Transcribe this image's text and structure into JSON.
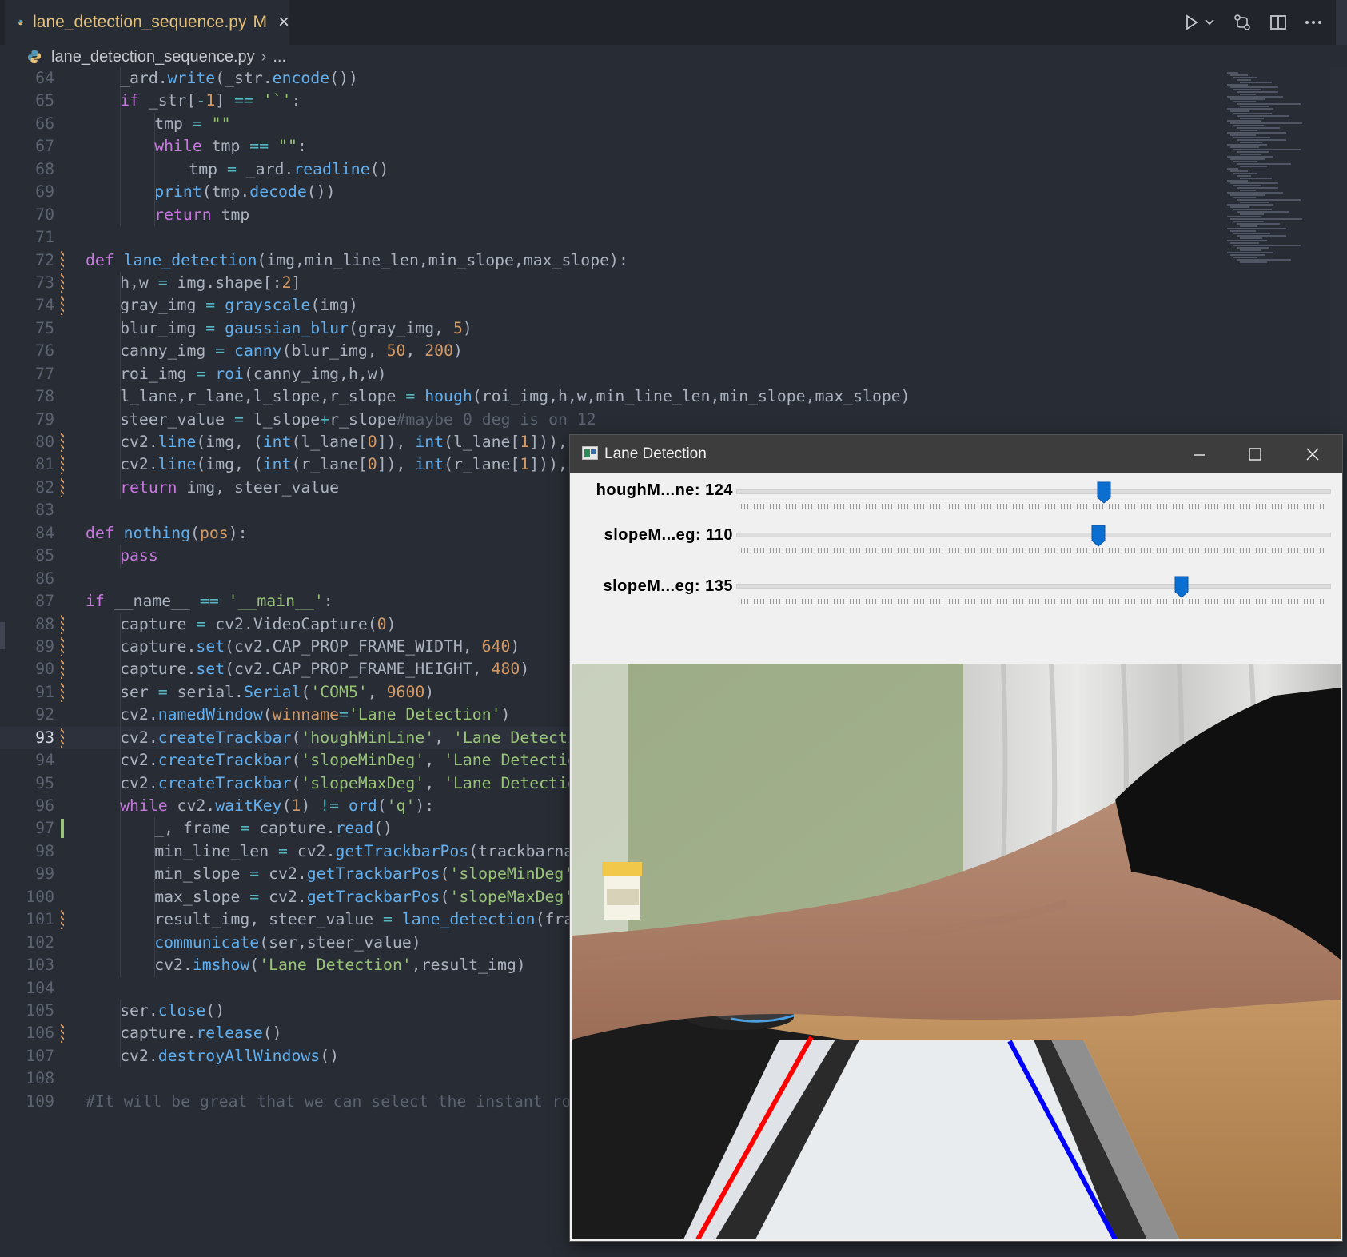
{
  "tab": {
    "filename": "lane_detection_sequence.py",
    "modified_badge": "M",
    "close_glyph": "×"
  },
  "breadcrumb": {
    "file": "lane_detection_sequence.py",
    "separator": "›",
    "more": "..."
  },
  "editor_actions": [
    "run-icon",
    "run-dropdown-icon",
    "open-changes-icon",
    "split-editor-icon",
    "more-actions-icon"
  ],
  "code": {
    "current_line": 93,
    "lines": [
      {
        "n": "64",
        "indent": 2,
        "tokens": [
          [
            "v",
            "_ard."
          ],
          [
            "f",
            "write"
          ],
          [
            "v",
            "(_str."
          ],
          [
            "f",
            "encode"
          ],
          [
            "v",
            "())"
          ]
        ]
      },
      {
        "n": "65",
        "indent": 2,
        "tokens": [
          [
            "k",
            "if"
          ],
          [
            "v",
            " _str["
          ],
          [
            "o",
            "-"
          ],
          [
            "n",
            "1"
          ],
          [
            "v",
            "] "
          ],
          [
            "o",
            "=="
          ],
          [
            "v",
            " "
          ],
          [
            "s",
            "'`'"
          ],
          [
            "v",
            ":"
          ]
        ]
      },
      {
        "n": "66",
        "indent": 3,
        "tokens": [
          [
            "v",
            "tmp "
          ],
          [
            "o",
            "="
          ],
          [
            "v",
            " "
          ],
          [
            "s",
            "\"\""
          ]
        ]
      },
      {
        "n": "67",
        "indent": 3,
        "tokens": [
          [
            "k",
            "while"
          ],
          [
            "v",
            " tmp "
          ],
          [
            "o",
            "=="
          ],
          [
            "v",
            " "
          ],
          [
            "s",
            "\"\""
          ],
          [
            "v",
            ":"
          ]
        ]
      },
      {
        "n": "68",
        "indent": 4,
        "tokens": [
          [
            "v",
            "tmp "
          ],
          [
            "o",
            "="
          ],
          [
            "v",
            " _ard."
          ],
          [
            "f",
            "readline"
          ],
          [
            "v",
            "()"
          ]
        ]
      },
      {
        "n": "69",
        "indent": 3,
        "tokens": [
          [
            "f",
            "print"
          ],
          [
            "v",
            "(tmp."
          ],
          [
            "f",
            "decode"
          ],
          [
            "v",
            "())"
          ]
        ]
      },
      {
        "n": "70",
        "indent": 3,
        "tokens": [
          [
            "k",
            "return"
          ],
          [
            "v",
            " tmp"
          ]
        ]
      },
      {
        "n": "71",
        "indent": 0,
        "tokens": []
      },
      {
        "n": "72",
        "indent": 1,
        "gutter": "mod",
        "tokens": [
          [
            "k",
            "def"
          ],
          [
            "v",
            " "
          ],
          [
            "f",
            "lane_detection"
          ],
          [
            "v",
            "(img,min_line_len,min_slope,max_slope):"
          ]
        ]
      },
      {
        "n": "73",
        "indent": 2,
        "gutter": "mod",
        "tokens": [
          [
            "v",
            "h,w "
          ],
          [
            "o",
            "="
          ],
          [
            "v",
            " img.shape[:"
          ],
          [
            "n",
            "2"
          ],
          [
            "v",
            "]"
          ]
        ]
      },
      {
        "n": "74",
        "indent": 2,
        "gutter": "mod",
        "tokens": [
          [
            "v",
            "gray_img "
          ],
          [
            "o",
            "="
          ],
          [
            "v",
            " "
          ],
          [
            "f",
            "grayscale"
          ],
          [
            "v",
            "(img)"
          ]
        ]
      },
      {
        "n": "75",
        "indent": 2,
        "tokens": [
          [
            "v",
            "blur_img "
          ],
          [
            "o",
            "="
          ],
          [
            "v",
            " "
          ],
          [
            "f",
            "gaussian_blur"
          ],
          [
            "v",
            "(gray_img, "
          ],
          [
            "n",
            "5"
          ],
          [
            "v",
            ")"
          ]
        ]
      },
      {
        "n": "76",
        "indent": 2,
        "tokens": [
          [
            "v",
            "canny_img "
          ],
          [
            "o",
            "="
          ],
          [
            "v",
            " "
          ],
          [
            "f",
            "canny"
          ],
          [
            "v",
            "(blur_img, "
          ],
          [
            "n",
            "50"
          ],
          [
            "v",
            ", "
          ],
          [
            "n",
            "200"
          ],
          [
            "v",
            ")"
          ]
        ]
      },
      {
        "n": "77",
        "indent": 2,
        "tokens": [
          [
            "v",
            "roi_img "
          ],
          [
            "o",
            "="
          ],
          [
            "v",
            " "
          ],
          [
            "f",
            "roi"
          ],
          [
            "v",
            "(canny_img,h,w)"
          ]
        ]
      },
      {
        "n": "78",
        "indent": 2,
        "tokens": [
          [
            "v",
            "l_lane,r_lane,l_slope,r_slope "
          ],
          [
            "o",
            "="
          ],
          [
            "v",
            " "
          ],
          [
            "f",
            "hough"
          ],
          [
            "v",
            "(roi_img,h,w,min_line_len,min_slope,max_slope)"
          ]
        ]
      },
      {
        "n": "79",
        "indent": 2,
        "tokens": [
          [
            "v",
            "steer_value "
          ],
          [
            "o",
            "="
          ],
          [
            "v",
            " l_slope"
          ],
          [
            "o",
            "+"
          ],
          [
            "v",
            "r_slope"
          ],
          [
            "c",
            "#maybe 0 deg is on 12"
          ]
        ]
      },
      {
        "n": "80",
        "indent": 2,
        "gutter": "mod",
        "tokens": [
          [
            "v",
            "cv2."
          ],
          [
            "f",
            "line"
          ],
          [
            "v",
            "(img, ("
          ],
          [
            "f",
            "int"
          ],
          [
            "v",
            "(l_lane["
          ],
          [
            "n",
            "0"
          ],
          [
            "v",
            "]), "
          ],
          [
            "f",
            "int"
          ],
          [
            "v",
            "(l_lane["
          ],
          [
            "n",
            "1"
          ],
          [
            "v",
            "])),"
          ]
        ]
      },
      {
        "n": "81",
        "indent": 2,
        "gutter": "mod",
        "tokens": [
          [
            "v",
            "cv2."
          ],
          [
            "f",
            "line"
          ],
          [
            "v",
            "(img, ("
          ],
          [
            "f",
            "int"
          ],
          [
            "v",
            "(r_lane["
          ],
          [
            "n",
            "0"
          ],
          [
            "v",
            "]), "
          ],
          [
            "f",
            "int"
          ],
          [
            "v",
            "(r_lane["
          ],
          [
            "n",
            "1"
          ],
          [
            "v",
            "])),"
          ]
        ]
      },
      {
        "n": "82",
        "indent": 2,
        "gutter": "mod",
        "tokens": [
          [
            "k",
            "return"
          ],
          [
            "v",
            " img, steer_value"
          ]
        ]
      },
      {
        "n": "83",
        "indent": 0,
        "tokens": []
      },
      {
        "n": "84",
        "indent": 1,
        "tokens": [
          [
            "k",
            "def"
          ],
          [
            "v",
            " "
          ],
          [
            "f",
            "nothing"
          ],
          [
            "v",
            "("
          ],
          [
            "n",
            "pos"
          ],
          [
            "v",
            "):"
          ]
        ]
      },
      {
        "n": "85",
        "indent": 2,
        "tokens": [
          [
            "k",
            "pass"
          ]
        ]
      },
      {
        "n": "86",
        "indent": 0,
        "tokens": []
      },
      {
        "n": "87",
        "indent": 1,
        "tokens": [
          [
            "k",
            "if"
          ],
          [
            "v",
            " __name__ "
          ],
          [
            "o",
            "=="
          ],
          [
            "v",
            " "
          ],
          [
            "s",
            "'__main__'"
          ],
          [
            "v",
            ":"
          ]
        ]
      },
      {
        "n": "88",
        "indent": 2,
        "gutter": "mod",
        "tokens": [
          [
            "v",
            "capture "
          ],
          [
            "o",
            "="
          ],
          [
            "v",
            " cv2.VideoCapture("
          ],
          [
            "n",
            "0"
          ],
          [
            "v",
            ")"
          ]
        ]
      },
      {
        "n": "89",
        "indent": 2,
        "gutter": "mod",
        "tokens": [
          [
            "v",
            "capture."
          ],
          [
            "f",
            "set"
          ],
          [
            "v",
            "(cv2.CAP_PROP_FRAME_WIDTH, "
          ],
          [
            "n",
            "640"
          ],
          [
            "v",
            ")"
          ]
        ]
      },
      {
        "n": "90",
        "indent": 2,
        "gutter": "mod",
        "tokens": [
          [
            "v",
            "capture."
          ],
          [
            "f",
            "set"
          ],
          [
            "v",
            "(cv2.CAP_PROP_FRAME_HEIGHT, "
          ],
          [
            "n",
            "480"
          ],
          [
            "v",
            ")"
          ]
        ]
      },
      {
        "n": "91",
        "indent": 2,
        "gutter": "mod",
        "tokens": [
          [
            "v",
            "ser "
          ],
          [
            "o",
            "="
          ],
          [
            "v",
            " serial."
          ],
          [
            "f",
            "Serial"
          ],
          [
            "v",
            "("
          ],
          [
            "s",
            "'COM5'"
          ],
          [
            "v",
            ", "
          ],
          [
            "n",
            "9600"
          ],
          [
            "v",
            ")"
          ]
        ]
      },
      {
        "n": "92",
        "indent": 2,
        "tokens": [
          [
            "v",
            "cv2."
          ],
          [
            "f",
            "namedWindow"
          ],
          [
            "v",
            "("
          ],
          [
            "n",
            "winname"
          ],
          [
            "o",
            "="
          ],
          [
            "s",
            "'Lane Detection'"
          ],
          [
            "v",
            ")"
          ]
        ]
      },
      {
        "n": "93",
        "indent": 2,
        "gutter": "mod",
        "tokens": [
          [
            "v",
            "cv2."
          ],
          [
            "f",
            "createTrackbar"
          ],
          [
            "v",
            "("
          ],
          [
            "s",
            "'houghMinLine'"
          ],
          [
            "v",
            ", "
          ],
          [
            "s",
            "'Lane Detecti"
          ]
        ]
      },
      {
        "n": "94",
        "indent": 2,
        "tokens": [
          [
            "v",
            "cv2."
          ],
          [
            "f",
            "createTrackbar"
          ],
          [
            "v",
            "("
          ],
          [
            "s",
            "'slopeMinDeg'"
          ],
          [
            "v",
            ", "
          ],
          [
            "s",
            "'Lane Detection"
          ]
        ]
      },
      {
        "n": "95",
        "indent": 2,
        "tokens": [
          [
            "v",
            "cv2."
          ],
          [
            "f",
            "createTrackbar"
          ],
          [
            "v",
            "("
          ],
          [
            "s",
            "'slopeMaxDeg'"
          ],
          [
            "v",
            ", "
          ],
          [
            "s",
            "'Lane Detection"
          ]
        ]
      },
      {
        "n": "96",
        "indent": 2,
        "tokens": [
          [
            "k",
            "while"
          ],
          [
            "v",
            " cv2."
          ],
          [
            "f",
            "waitKey"
          ],
          [
            "v",
            "("
          ],
          [
            "n",
            "1"
          ],
          [
            "v",
            ") "
          ],
          [
            "o",
            "!="
          ],
          [
            "v",
            " "
          ],
          [
            "f",
            "ord"
          ],
          [
            "v",
            "("
          ],
          [
            "s",
            "'q'"
          ],
          [
            "v",
            "):"
          ]
        ]
      },
      {
        "n": "97",
        "indent": 3,
        "gutter": "add",
        "tokens": [
          [
            "v",
            "_, frame "
          ],
          [
            "o",
            "="
          ],
          [
            "v",
            " capture."
          ],
          [
            "f",
            "read"
          ],
          [
            "v",
            "()"
          ]
        ]
      },
      {
        "n": "98",
        "indent": 3,
        "tokens": [
          [
            "v",
            "min_line_len "
          ],
          [
            "o",
            "="
          ],
          [
            "v",
            " cv2."
          ],
          [
            "f",
            "getTrackbarPos"
          ],
          [
            "v",
            "(trackbarna"
          ]
        ]
      },
      {
        "n": "99",
        "indent": 3,
        "tokens": [
          [
            "v",
            "min_slope "
          ],
          [
            "o",
            "="
          ],
          [
            "v",
            " cv2."
          ],
          [
            "f",
            "getTrackbarPos"
          ],
          [
            "v",
            "("
          ],
          [
            "s",
            "'slopeMinDeg'"
          ]
        ]
      },
      {
        "n": "100",
        "indent": 3,
        "tokens": [
          [
            "v",
            "max_slope "
          ],
          [
            "o",
            "="
          ],
          [
            "v",
            " cv2."
          ],
          [
            "f",
            "getTrackbarPos"
          ],
          [
            "v",
            "("
          ],
          [
            "s",
            "'slopeMaxDeg'"
          ]
        ]
      },
      {
        "n": "101",
        "indent": 3,
        "gutter": "mod",
        "tokens": [
          [
            "v",
            "result_img, steer_value "
          ],
          [
            "o",
            "="
          ],
          [
            "v",
            " "
          ],
          [
            "f",
            "lane_detection"
          ],
          [
            "v",
            "(fra"
          ]
        ]
      },
      {
        "n": "102",
        "indent": 3,
        "tokens": [
          [
            "f",
            "communicate"
          ],
          [
            "v",
            "(ser,steer_value)"
          ]
        ]
      },
      {
        "n": "103",
        "indent": 3,
        "tokens": [
          [
            "v",
            "cv2."
          ],
          [
            "f",
            "imshow"
          ],
          [
            "v",
            "("
          ],
          [
            "s",
            "'Lane Detection'"
          ],
          [
            "v",
            ",result_img)"
          ]
        ]
      },
      {
        "n": "104",
        "indent": 0,
        "tokens": []
      },
      {
        "n": "105",
        "indent": 2,
        "tokens": [
          [
            "v",
            "ser."
          ],
          [
            "f",
            "close"
          ],
          [
            "v",
            "()"
          ]
        ]
      },
      {
        "n": "106",
        "indent": 2,
        "gutter": "mod",
        "tokens": [
          [
            "v",
            "capture."
          ],
          [
            "f",
            "release"
          ],
          [
            "v",
            "()"
          ]
        ]
      },
      {
        "n": "107",
        "indent": 2,
        "tokens": [
          [
            "v",
            "cv2."
          ],
          [
            "f",
            "destroyAllWindows"
          ],
          [
            "v",
            "()"
          ]
        ]
      },
      {
        "n": "108",
        "indent": 0,
        "tokens": []
      },
      {
        "n": "109",
        "indent": 1,
        "tokens": [
          [
            "c",
            "#It will be great that we can select the instant roi"
          ]
        ]
      }
    ]
  },
  "lane_window": {
    "title": "Lane Detection",
    "app_icon": "opencv-window-icon",
    "controls": [
      "minimize-icon",
      "maximize-icon",
      "close-icon"
    ],
    "trackbars": [
      {
        "label": "houghM...ne: 124",
        "value": 124,
        "max": 200
      },
      {
        "label": "slopeM...eg: 110",
        "value": 110,
        "max": 180
      },
      {
        "label": "slopeM...eg: 135",
        "value": 135,
        "max": 180
      }
    ],
    "camera": {
      "description_colors": {
        "wall": "#9fb08a",
        "curtain": "#d8d8d6",
        "arm": "#b78a73",
        "desk": "#b88c5e",
        "mat": "#1c1c1c",
        "paper": "#e6eaee"
      },
      "lane_colors": {
        "left": "#ff0000",
        "right": "#0000ff"
      }
    }
  }
}
